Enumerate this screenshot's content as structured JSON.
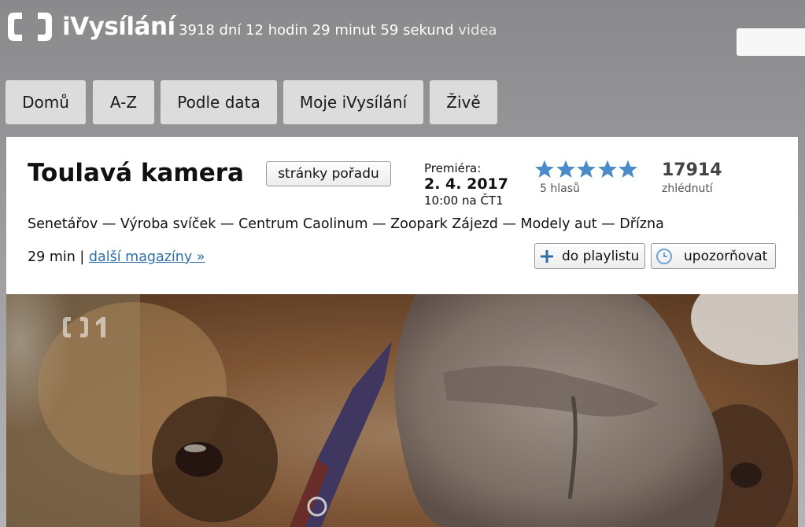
{
  "header": {
    "logo_text": "iVysílání",
    "counter_text": "3918 dní 12 hodin 29 minut 59 sekund",
    "counter_suffix": "videa"
  },
  "nav": {
    "tabs": [
      {
        "label": "Domů"
      },
      {
        "label": "A-Z"
      },
      {
        "label": "Podle data"
      },
      {
        "label": "Moje iVysílání"
      },
      {
        "label": "Živě"
      }
    ]
  },
  "show": {
    "title": "Toulavá kamera",
    "page_button_label": "stránky pořadu",
    "premiere_label": "Premiéra:",
    "premiere_date": "2. 4. 2017",
    "premiere_time": "10:00 na ČT1",
    "rating_stars": 5,
    "votes": "5 hlasů",
    "views_count": "17914",
    "views_label": "zhlédnutí",
    "topics": "Senetářov — Výroba svíček — Centrum Caolinum — Zoopark Zájezd — Modely aut — Dřízna",
    "duration": "29 min",
    "separator": "|",
    "more_link": "další magazíny »",
    "playlist_button_label": "do playlistu",
    "notify_button_label": "upozorňovat"
  },
  "video": {
    "channel_logo": "ČT1",
    "subject": "camel-close-up"
  },
  "colors": {
    "star": "#4a8cc8",
    "link": "#2f6fa8",
    "plus_icon": "#2f6fa8",
    "clock_icon": "#6ea3d2"
  }
}
